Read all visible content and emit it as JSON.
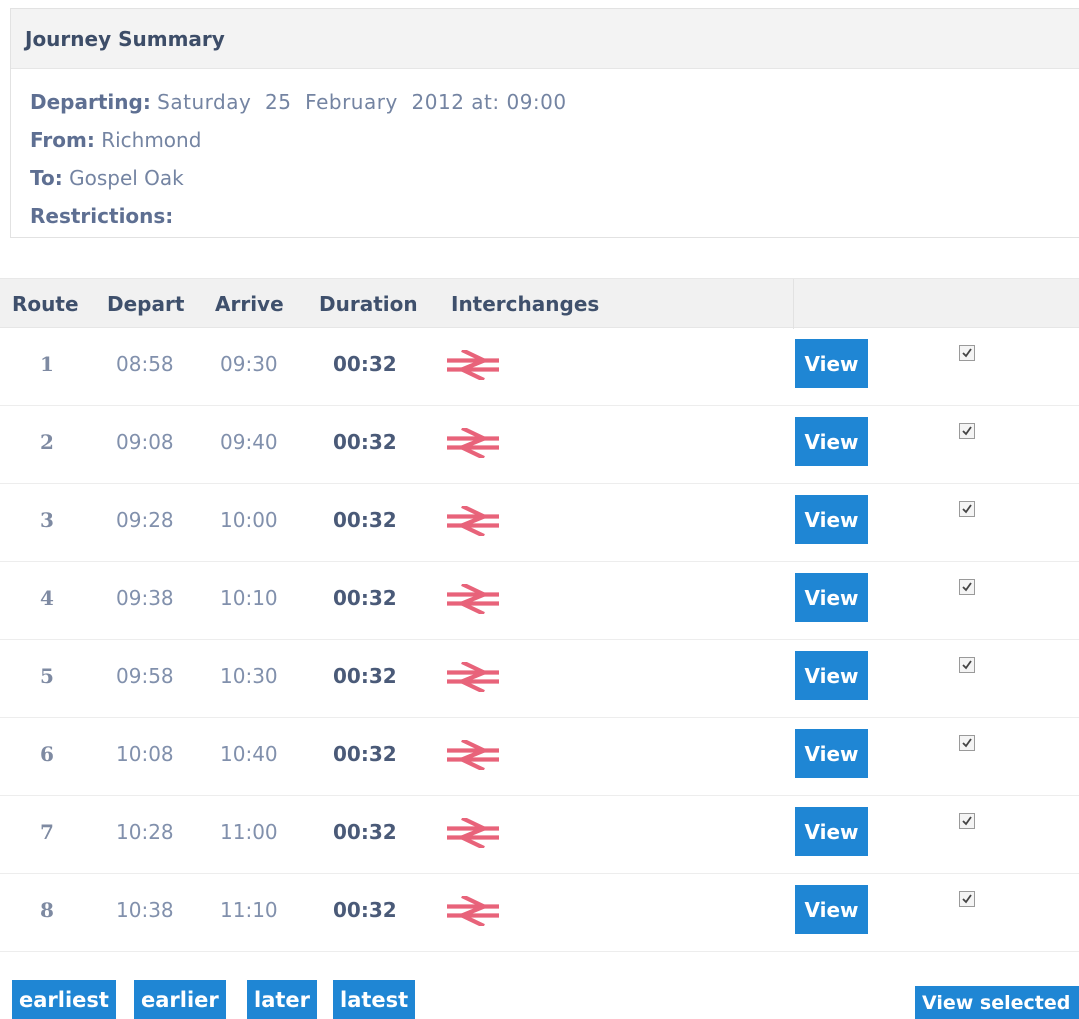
{
  "summary": {
    "title": "Journey Summary",
    "departing_label": "Departing:",
    "departing_value": "Saturday  25  February  2012 at: 09:00",
    "from_label": "From:",
    "from_value": "Richmond",
    "to_label": "To:",
    "to_value": "Gospel Oak",
    "restrictions_label": "Restrictions:"
  },
  "table": {
    "headers": [
      "Route",
      "Depart",
      "Arrive",
      "Duration",
      "Interchanges"
    ],
    "view_label": "View",
    "rows": [
      {
        "route": "1",
        "depart": "08:58",
        "arrive": "09:30",
        "duration": "00:32",
        "icon": "national-rail-icon",
        "selected": true
      },
      {
        "route": "2",
        "depart": "09:08",
        "arrive": "09:40",
        "duration": "00:32",
        "icon": "national-rail-icon",
        "selected": true
      },
      {
        "route": "3",
        "depart": "09:28",
        "arrive": "10:00",
        "duration": "00:32",
        "icon": "national-rail-icon",
        "selected": true
      },
      {
        "route": "4",
        "depart": "09:38",
        "arrive": "10:10",
        "duration": "00:32",
        "icon": "national-rail-icon",
        "selected": true
      },
      {
        "route": "5",
        "depart": "09:58",
        "arrive": "10:30",
        "duration": "00:32",
        "icon": "national-rail-icon",
        "selected": true
      },
      {
        "route": "6",
        "depart": "10:08",
        "arrive": "10:40",
        "duration": "00:32",
        "icon": "national-rail-icon",
        "selected": true
      },
      {
        "route": "7",
        "depart": "10:28",
        "arrive": "11:00",
        "duration": "00:32",
        "icon": "national-rail-icon",
        "selected": true
      },
      {
        "route": "8",
        "depart": "10:38",
        "arrive": "11:10",
        "duration": "00:32",
        "icon": "national-rail-icon",
        "selected": true
      }
    ]
  },
  "nav": {
    "earliest": "earliest",
    "earlier": "earlier",
    "later": "later",
    "latest": "latest",
    "view_selected": "View selected"
  },
  "colors": {
    "button": "#1f86d4",
    "rail_icon": "#e8637a",
    "header_bg": "#f1f1f1"
  }
}
